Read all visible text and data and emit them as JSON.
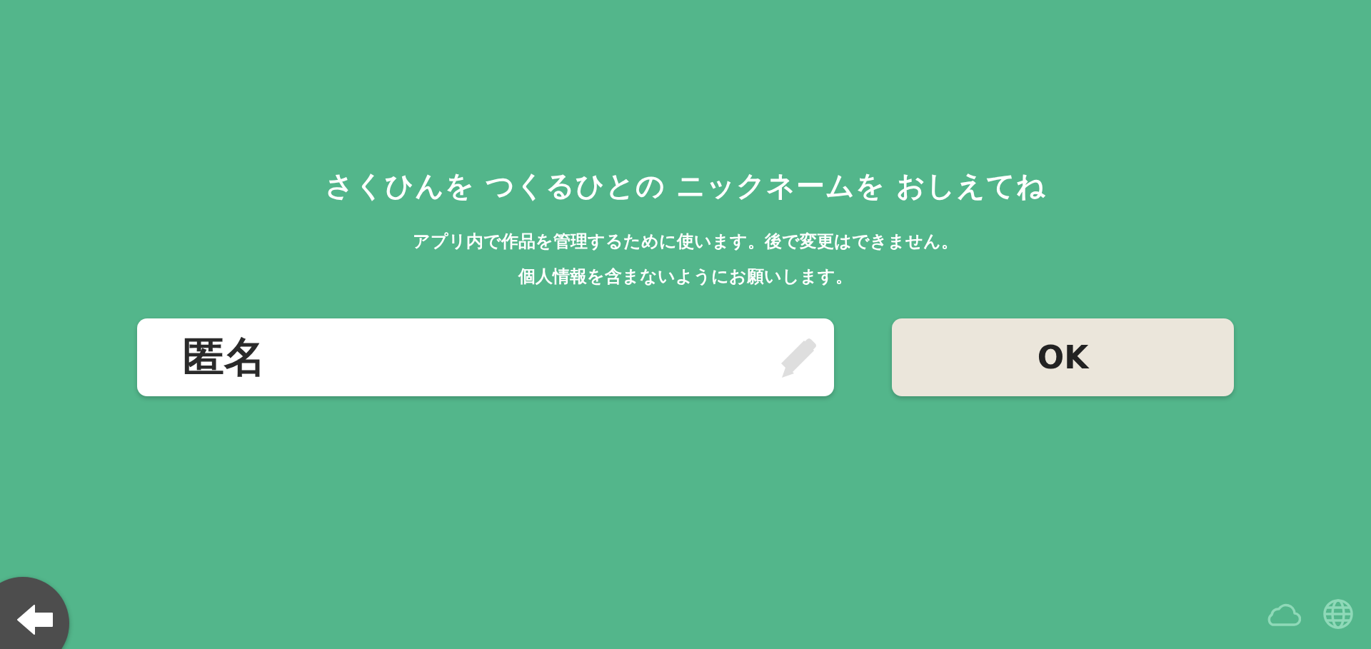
{
  "title": "さくひんを つくるひとの ニックネームを おしえてね",
  "description": [
    "アプリ内で作品を管理するために使います。後で変更はできません。",
    "個人情報を含まないようにお願いします。"
  ],
  "nickname_field": {
    "value": "匿名"
  },
  "ok_button": {
    "label": "OK"
  }
}
